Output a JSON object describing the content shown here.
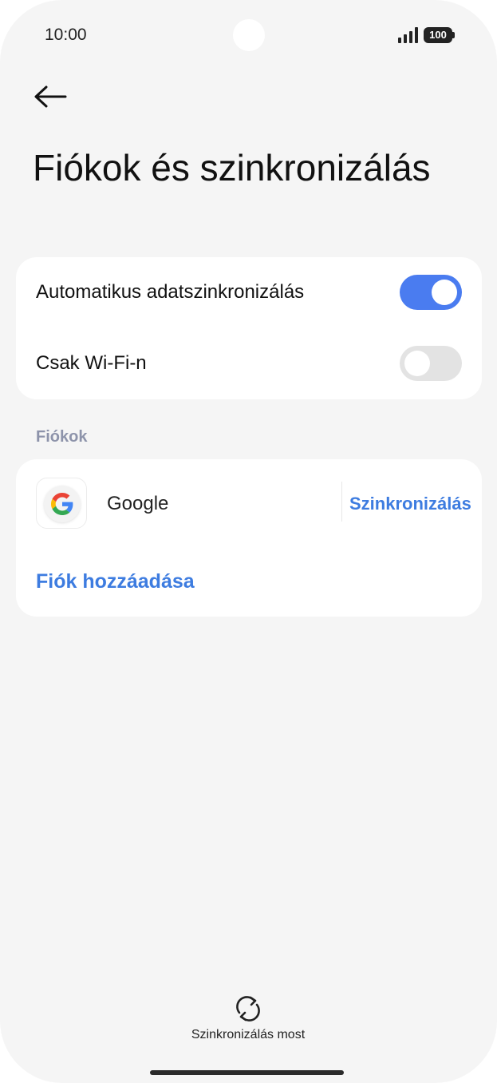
{
  "status_bar": {
    "time": "10:00",
    "battery": "100"
  },
  "header": {
    "title": "Fiókok és szinkronizálás",
    "back_icon": "arrow-left-icon"
  },
  "sync_settings": {
    "items": [
      {
        "label": "Automatikus adatszinkronizálás",
        "enabled": true
      },
      {
        "label": "Csak Wi-Fi-n",
        "enabled": false
      }
    ]
  },
  "accounts_section": {
    "header": "Fiókok",
    "accounts": [
      {
        "name": "Google",
        "icon": "google-icon",
        "action_label": "Szinkronizálás"
      }
    ],
    "add_account_label": "Fiók hozzáadása"
  },
  "bottom_action": {
    "label": "Szinkronizálás most",
    "icon": "sync-icon"
  },
  "colors": {
    "accent": "#3d7ce0",
    "toggle_on": "#4a7cf0",
    "background": "#f5f5f5"
  }
}
